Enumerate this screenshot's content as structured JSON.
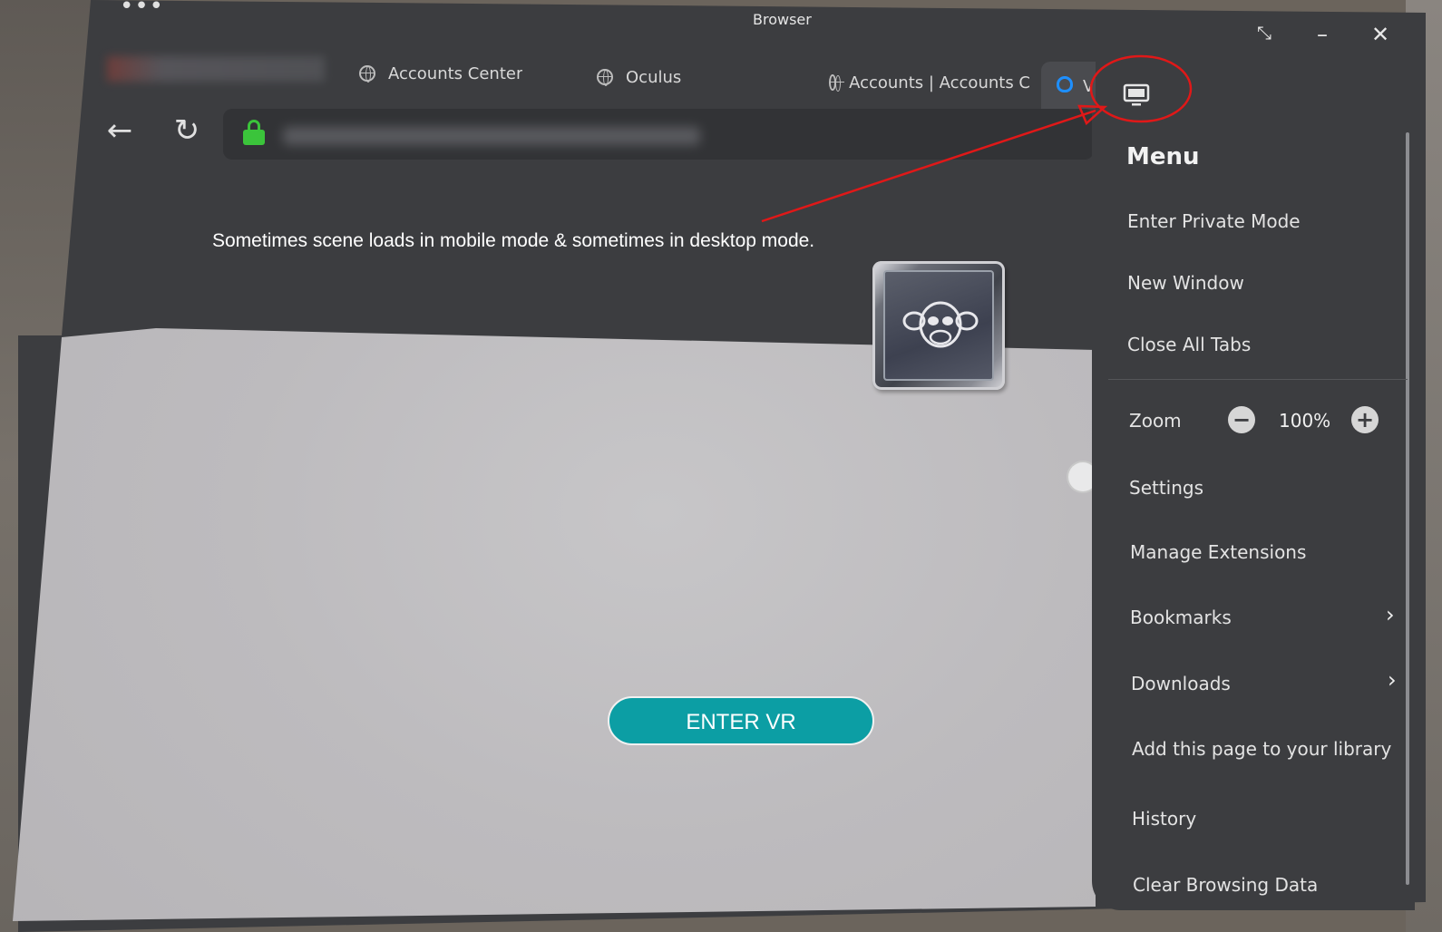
{
  "window": {
    "title": "Browser",
    "menu_dots": "•••",
    "controls": {
      "collapse": "⤡",
      "minimize": "–",
      "close": "✕"
    }
  },
  "tabs": [
    {
      "label": "Accounts Center"
    },
    {
      "label": "Oculus"
    },
    {
      "label": "Accounts | Accounts C"
    },
    {
      "label": "V"
    }
  ],
  "toolbar": {
    "back_icon": "←",
    "reload_icon": "↻"
  },
  "content": {
    "annotation": "Sometimes scene loads in mobile mode & sometimes in desktop mode.",
    "enter_vr_label": "ENTER VR"
  },
  "menu": {
    "title": "Menu",
    "items_top": [
      "Enter Private Mode",
      "New Window",
      "Close All Tabs"
    ],
    "zoom": {
      "label": "Zoom",
      "value": "100%",
      "minus": "−",
      "plus": "+"
    },
    "items_bottom": [
      "Settings",
      "Manage Extensions",
      "Bookmarks",
      "Downloads",
      "Add this page to your library",
      "History",
      "Clear Browsing Data"
    ],
    "chevron": "›"
  },
  "colors": {
    "annotation_red": "#e01818",
    "enter_vr": "#0c9ea4",
    "lock": "#3bc43b",
    "panel": "#3c3d40"
  }
}
